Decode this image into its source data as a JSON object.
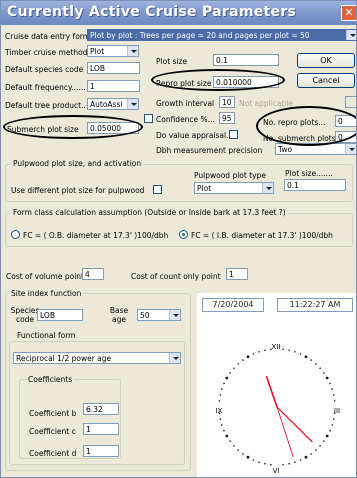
{
  "window": {
    "title": "Currently Active Cruise Parameters",
    "close_symbol": "✕"
  },
  "form": {
    "entry_form_label": "Cruise data entry form",
    "entry_form_value": "Plot by plot : Trees per page = 20 and pages per plot = 50",
    "timber_method_label": "Timber cruise method",
    "timber_method_value": "Plot",
    "species_code_label": "Default species code",
    "species_code_value": "LOB",
    "frequency_label": "Default frequency......",
    "frequency_value": "1",
    "tree_product_label": "Default tree product..",
    "tree_product_value": "AutoAssi",
    "submerch_plot_label": "Submerch plot size",
    "submerch_plot_value": "0.05000",
    "plot_size_label": "Plot size",
    "plot_size_value": "0.1",
    "repro_plot_label": "Repro plot size",
    "repro_plot_value": "0.010000",
    "growth_interval_label": "Growth interval",
    "growth_interval_value": "10",
    "growth_interval_suffix": "Not applicable",
    "confidence_label": "Confidence %...",
    "confidence_value": "95",
    "do_value_label": "Do value appraisal.....",
    "dbh_precision_label": "Dbh measurement precision",
    "dbh_precision_value": "Two",
    "no_repro_label": "No. repro plots...",
    "no_repro_value": "0",
    "no_submerch_label": "No. submerch plots",
    "no_submerch_value": "0",
    "ok_label": "OK",
    "cancel_label": "Cancel"
  },
  "pulpwood": {
    "group_title": "Pulpwood plot size, and activation",
    "use_diff_label": "Use different plot size for pulpwood",
    "plot_type_label": "Pulpwood plot type",
    "plot_type_value": "Plot",
    "plot_size_label": "Plot size.......",
    "plot_size_value": "0.1"
  },
  "form_class": {
    "group_title": "Form class calculation assumption (Outside or Inside bark at 17.3 feet ?)",
    "option_outside": "FC = ( O.B. diameter at 17.3' )100/dbh",
    "option_inside": "FC = ( I.B. diameter at 17.3' )100/dbh"
  },
  "costs": {
    "volume_point_label": "Cost of volume point",
    "volume_point_value": "4",
    "count_point_label": "Cost of count only point",
    "count_point_value": "1"
  },
  "site_index": {
    "group_title": "Site index function",
    "species_label": "Species code",
    "species_value": "LOB",
    "base_age_label": "Base age",
    "base_age_value": "50",
    "functional_form_title": "Functional form",
    "functional_form_value": "Reciprocal 1/2 power age",
    "coefficients_title": "Coefficients",
    "coef_b_label": "Coefficient b",
    "coef_b_value": "6.32",
    "coef_c_label": "Coefficient c",
    "coef_c_value": "1",
    "coef_d_label": "Coefficient d",
    "coef_d_value": "1"
  },
  "clock": {
    "date": "7/20/2004",
    "time": "11:22:27 AM",
    "numeral_12": "XII",
    "numeral_3": "III",
    "numeral_6": "VI",
    "numeral_9": "IX",
    "hour": 11,
    "minute": 22,
    "second": 27,
    "hand_color": "#e8001c",
    "dot_color": "#1a1a1a"
  }
}
